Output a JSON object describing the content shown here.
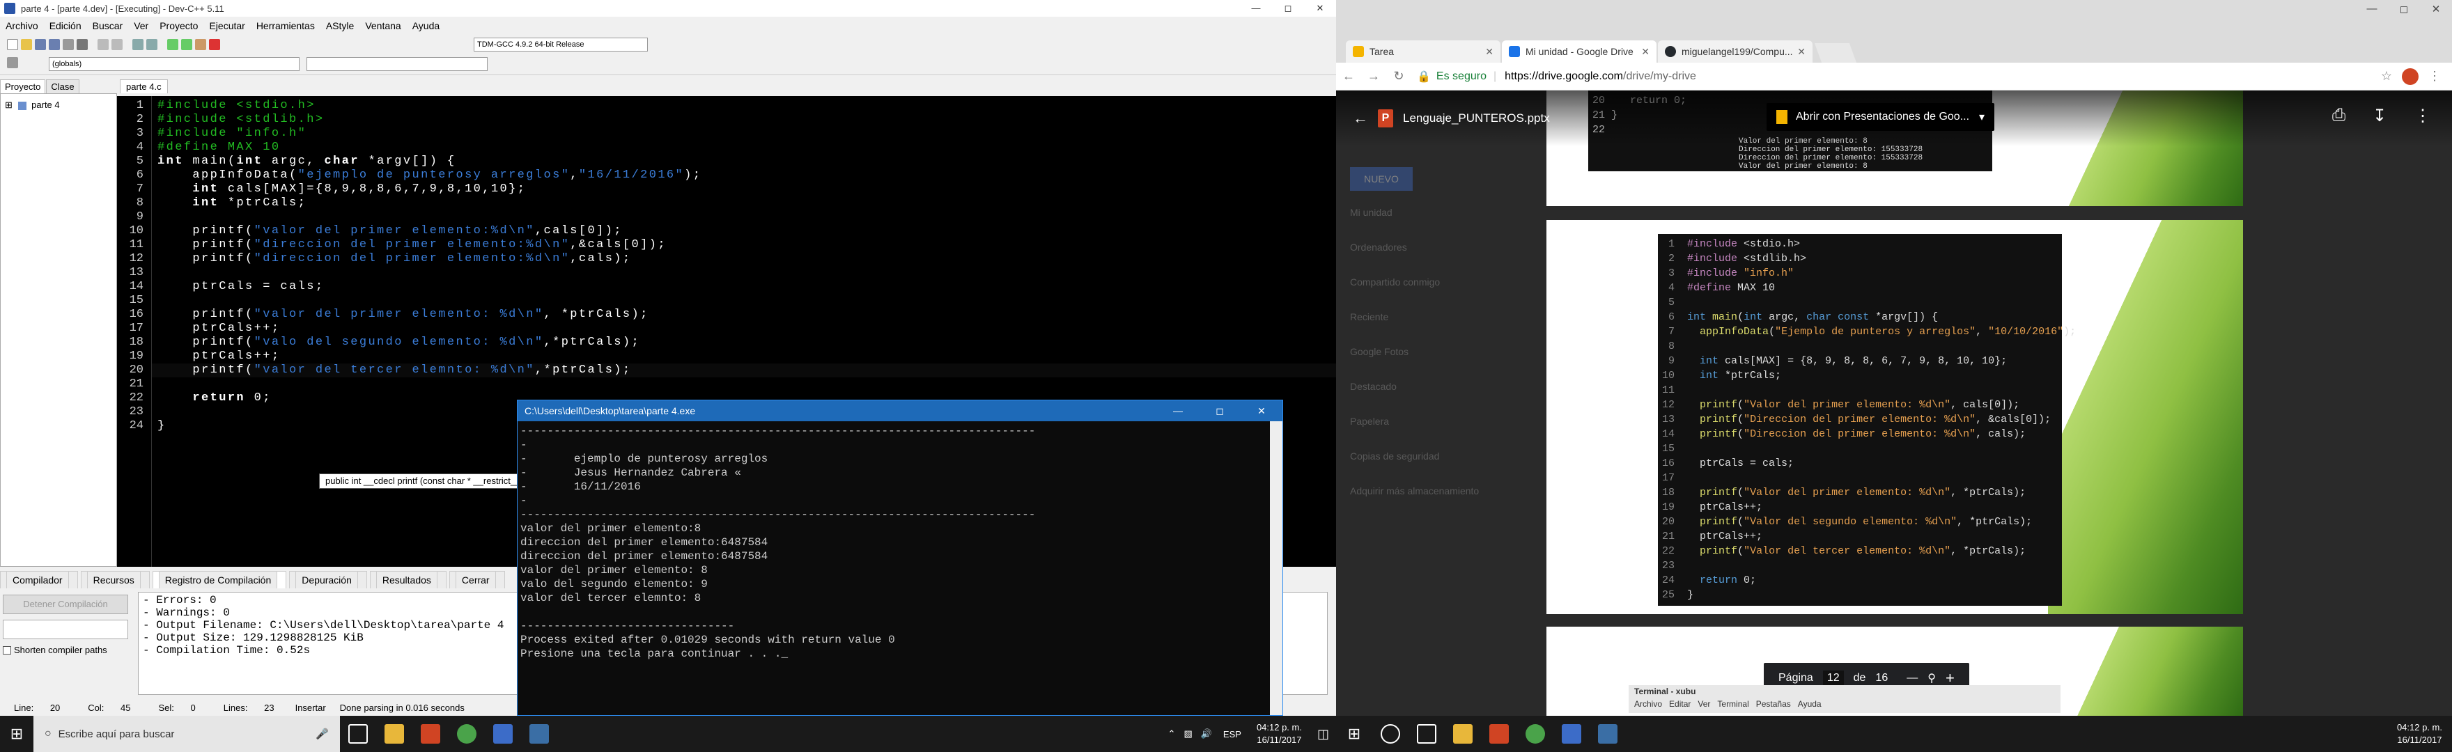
{
  "devcpp": {
    "title": "parte 4 - [parte 4.dev] - [Executing] - Dev-C++ 5.11",
    "menu": [
      "Archivo",
      "Edición",
      "Buscar",
      "Ver",
      "Proyecto",
      "Ejecutar",
      "Herramientas",
      "AStyle",
      "Ventana",
      "Ayuda"
    ],
    "compiler_combo": "TDM-GCC 4.9.2 64-bit Release",
    "scope_combo": "(globals)",
    "left_tabs": [
      "Proyecto",
      "Clase"
    ],
    "project_name": "parte 4",
    "editor_tab": "parte 4.c",
    "code_lines": [
      "#include <stdio.h>",
      "#include <stdlib.h>",
      "#include \"info.h\"",
      "#define MAX 10",
      "int main(int argc, char *argv[]) {",
      "    appInfoData(\"ejemplo de punterosy arreglos\",\"16/11/2016\");",
      "    int cals[MAX]={8,9,8,8,6,7,9,8,10,10};",
      "    int *ptrCals;",
      "",
      "    printf(\"valor del primer elemento:%d\\n\",cals[0]);",
      "    printf(\"direccion del primer elemento:%d\\n\",&cals[0]);",
      "    printf(\"direccion del primer elemento:%d\\n\",cals);",
      "",
      "    ptrCals = cals;",
      "",
      "    printf(\"valor del primer elemento: %d\\n\", *ptrCals);",
      "    ptrCals++;",
      "    printf(\"valo del segundo elemento: %d\\n\",*ptrCals);",
      "    ptrCals++;",
      "    printf(\"valor del tercer elemnto: %d\\n\",*ptrCals);",
      "",
      "    return 0;",
      "",
      "}"
    ],
    "tooltip": "public int __cdecl printf (const char * __restrict__ _Format, ...)",
    "bottom_tabs": [
      "Compilador",
      "Recursos",
      "Registro de Compilación",
      "Depuración",
      "Resultados",
      "Cerrar"
    ],
    "abort_button": "Detener Compilación",
    "shorten_paths": "Shorten compiler paths",
    "log": [
      "- Errors: 0",
      "- Warnings: 0",
      "- Output Filename: C:\\Users\\dell\\Desktop\\tarea\\parte 4",
      "- Output Size: 129.1298828125 KiB",
      "- Compilation Time: 0.52s"
    ],
    "status": {
      "line": "Line:",
      "line_val": "20",
      "col": "Col:",
      "col_val": "45",
      "sel": "Sel:",
      "sel_val": "0",
      "lines": "Lines:",
      "lines_val": "23",
      "mode": "Insertar",
      "parse": "Done parsing in 0.016 seconds"
    }
  },
  "console": {
    "title": "C:\\Users\\dell\\Desktop\\tarea\\parte 4.exe",
    "lines": [
      "-----------------------------------------------------------------------------",
      "-",
      "-       ejemplo de punterosy arreglos",
      "-       Jesus Hernandez Cabrera «",
      "-       16/11/2016",
      "-",
      "-----------------------------------------------------------------------------",
      "valor del primer elemento:8",
      "direccion del primer elemento:6487584",
      "direccion del primer elemento:6487584",
      "valor del primer elemento: 8",
      "valo del segundo elemento: 9",
      "valor del tercer elemnto: 8",
      "",
      "--------------------------------",
      "Process exited after 0.01029 seconds with return value 0",
      "Presione una tecla para continuar . . ."
    ]
  },
  "taskbar_left": {
    "search_placeholder": "Escribe aquí para buscar",
    "lang": "ESP",
    "time": "04:12 p. m.",
    "date": "16/11/2017"
  },
  "chrome": {
    "tabs": [
      {
        "label": "Tarea",
        "color": "#f4b400"
      },
      {
        "label": "Mi unidad - Google Drive",
        "color": "#1a73e8"
      },
      {
        "label": "miguelangel199/Compu...",
        "color": "#24292e"
      }
    ],
    "secure_label": "Es seguro",
    "url_host": "https://drive.google.com",
    "url_path": "/drive/my-drive",
    "file_name": "Lenguaje_PUNTEROS.pptx",
    "open_with": "Abrir con Presentaciones de Goo...",
    "top_code": [
      "20    return 0;",
      "21 }",
      "22"
    ],
    "top_console": [
      "Valor del primer elemento: 8",
      "Direccion del primer elemento: 155333728",
      "Direccion del primer elemento: 155333728",
      "Valor del primer elemento: 8"
    ],
    "slide_code": [
      [
        "1",
        "#include <stdio.h>"
      ],
      [
        "2",
        "#include <stdlib.h>"
      ],
      [
        "3",
        "#include \"info.h\""
      ],
      [
        "4",
        "#define MAX 10"
      ],
      [
        "5",
        ""
      ],
      [
        "6",
        "int main(int argc, char const *argv[]) {"
      ],
      [
        "7",
        "  appInfoData(\"Ejemplo de punteros y arreglos\", \"10/10/2016\");"
      ],
      [
        "8",
        ""
      ],
      [
        "9",
        "  int cals[MAX] = {8, 9, 8, 8, 6, 7, 9, 8, 10, 10};"
      ],
      [
        "10",
        "  int *ptrCals;"
      ],
      [
        "11",
        ""
      ],
      [
        "12",
        "  printf(\"Valor del primer elemento: %d\\n\", cals[0]);"
      ],
      [
        "13",
        "  printf(\"Direccion del primer elemento: %d\\n\", &cals[0]);"
      ],
      [
        "14",
        "  printf(\"Direccion del primer elemento: %d\\n\", cals);"
      ],
      [
        "15",
        ""
      ],
      [
        "16",
        "  ptrCals = cals;"
      ],
      [
        "17",
        ""
      ],
      [
        "18",
        "  printf(\"Valor del primer elemento: %d\\n\", *ptrCals);"
      ],
      [
        "19",
        "  ptrCals++;"
      ],
      [
        "20",
        "  printf(\"Valor del segundo elemento: %d\\n\", *ptrCals);"
      ],
      [
        "21",
        "  ptrCals++;"
      ],
      [
        "22",
        "  printf(\"Valor del tercer elemento: %d\\n\", *ptrCals);"
      ],
      [
        "23",
        ""
      ],
      [
        "24",
        "  return 0;"
      ],
      [
        "25",
        "}"
      ]
    ],
    "pager": {
      "label": "Página",
      "current": "12",
      "of": "de",
      "total": "16"
    },
    "bg_sidebar": [
      "NUEVO",
      "Mi unidad",
      "Ordenadores",
      "Compartido conmigo",
      "Reciente",
      "Google Fotos",
      "Destacado",
      "Papelera",
      "Copias de seguridad",
      "Adquirir más almacenamiento"
    ],
    "mini_terminal": {
      "title": "Terminal - xubu",
      "menu": [
        "Archivo",
        "Editar",
        "Ver",
        "Terminal",
        "Pestañas",
        "Ayuda"
      ]
    }
  },
  "taskbar_right": {
    "time": "04:12 p. m.",
    "date": "16/11/2017"
  }
}
